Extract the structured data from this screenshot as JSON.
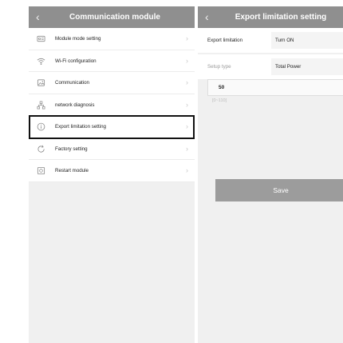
{
  "left": {
    "title": "Communication module",
    "back_icon": "chevron-left-icon",
    "items": [
      {
        "label": "Module mode setting",
        "icon": "id-card-icon"
      },
      {
        "label": "Wi-Fi configuration",
        "icon": "wifi-icon"
      },
      {
        "label": "Communication",
        "icon": "image-icon"
      },
      {
        "label": "network diagnosis",
        "icon": "network-icon"
      },
      {
        "label": "Export limitation setting",
        "icon": "info-icon",
        "highlighted": true
      },
      {
        "label": "Factory setting",
        "icon": "refresh-icon"
      },
      {
        "label": "Restart module",
        "icon": "power-icon"
      }
    ]
  },
  "right": {
    "title": "Export limitation setting",
    "back_icon": "chevron-left-icon",
    "export_limitation": {
      "label": "Export limitation",
      "value": "Turn ON"
    },
    "setup_type": {
      "label": "Setup type",
      "value": "Total Power"
    },
    "power_input": {
      "value": "50",
      "range_hint": "[0~110]"
    },
    "save_label": "Save"
  },
  "colors": {
    "titlebar": "#8f8f8f",
    "panel_background": "#f0f0f0",
    "save_button": "#9c9c9c",
    "highlight_border": "#111111"
  }
}
